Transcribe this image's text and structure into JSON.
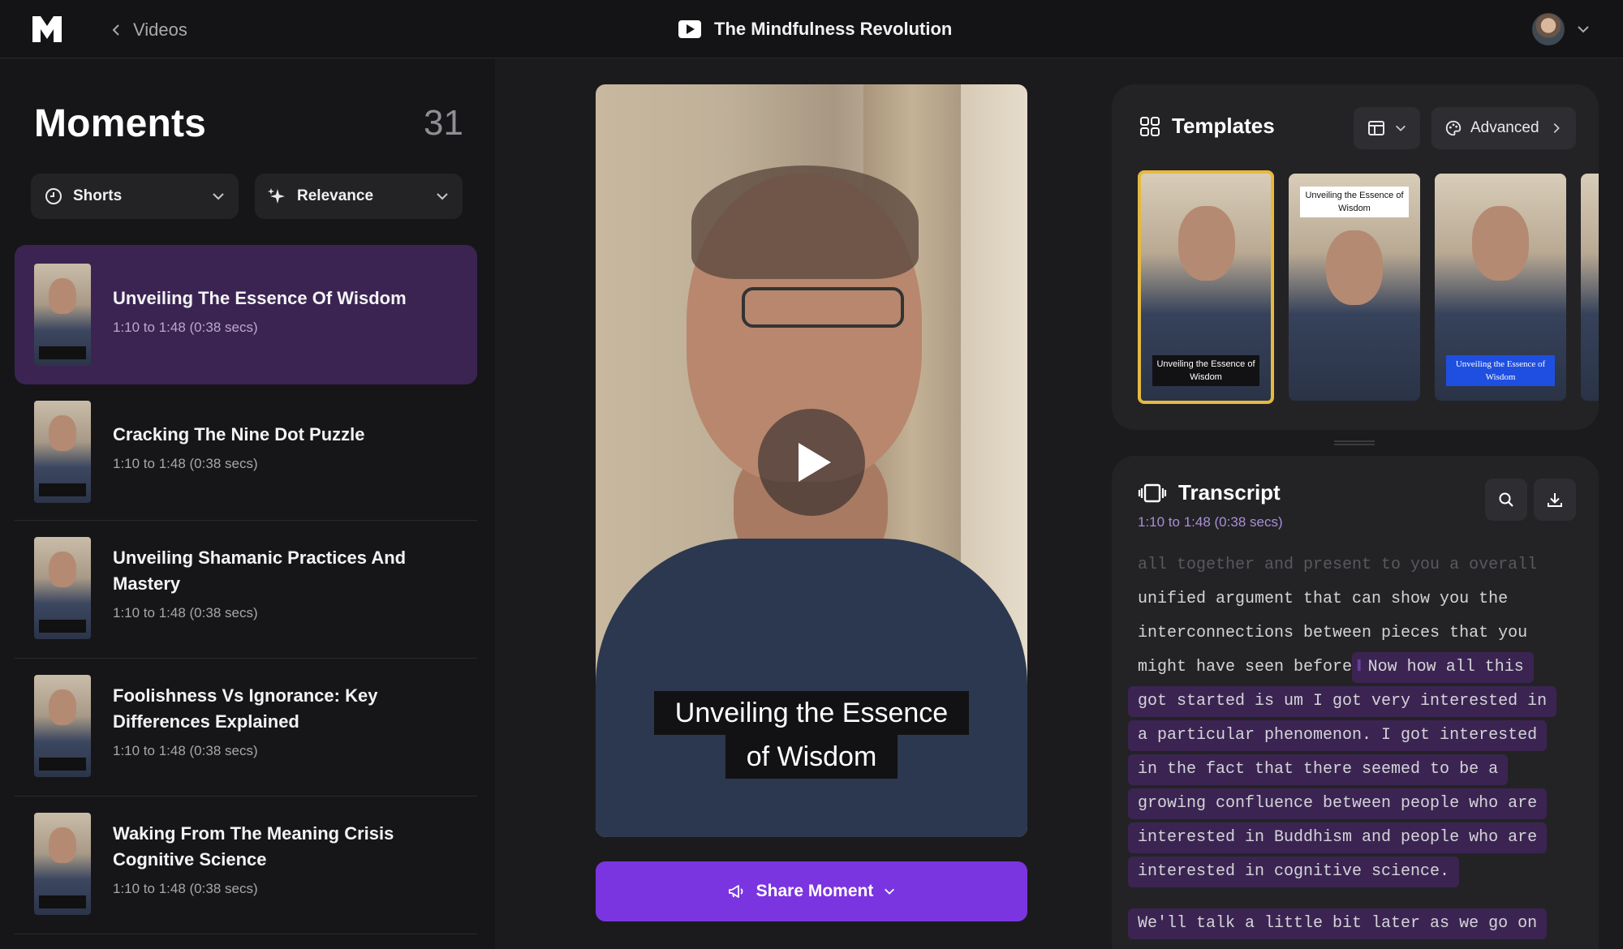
{
  "header": {
    "back_label": "Videos",
    "doc_title": "The Mindfulness Revolution"
  },
  "moments": {
    "title": "Moments",
    "count": "31",
    "filters": {
      "type_label": "Shorts",
      "sort_label": "Relevance"
    },
    "items": [
      {
        "title": "Unveiling The Essence Of Wisdom",
        "time": "1:10 to 1:48 (0:38 secs)"
      },
      {
        "title": "Cracking The Nine Dot Puzzle",
        "time": "1:10 to 1:48 (0:38 secs)"
      },
      {
        "title": "Unveiling Shamanic Practices And Mastery",
        "time": "1:10 to 1:48 (0:38 secs)"
      },
      {
        "title": "Foolishness Vs Ignorance: Key Differences Explained",
        "time": "1:10 to 1:48 (0:38 secs)"
      },
      {
        "title": "Waking From The Meaning Crisis Cognitive Science",
        "time": "1:10 to 1:48 (0:38 secs)"
      }
    ]
  },
  "player": {
    "caption_line1": "Unveiling the Essence",
    "caption_line2": "of Wisdom",
    "share_label": "Share Moment"
  },
  "templates": {
    "title": "Templates",
    "advanced_label": "Advanced",
    "cards": [
      {
        "caption": "Unveiling the Essence of Wisdom",
        "style": "dark",
        "selected": true
      },
      {
        "caption": "Unveiling the Essence of Wisdom",
        "style": "white",
        "selected": false
      },
      {
        "caption": "Unveiling the Essence of Wisdom",
        "style": "blue",
        "selected": false
      }
    ]
  },
  "transcript": {
    "title": "Transcript",
    "range": "1:10 to 1:48 (0:38 secs)",
    "lines": [
      "all together and present to you a overall",
      "unified argument that can show you the",
      "interconnections between pieces that you",
      "might have seen before",
      "Now how all this",
      "got started is um I got very interested in",
      "a particular phenomenon. I got interested",
      "in the fact that there seemed to be a",
      "growing confluence between people who are",
      "interested in Buddhism and people who are",
      "interested in cognitive science.",
      "We'll talk a little bit later as we go on"
    ]
  },
  "colors": {
    "accent_purple": "#7b35e0",
    "active_row": "#3b2452",
    "selected_template_border": "#e6b93f"
  }
}
